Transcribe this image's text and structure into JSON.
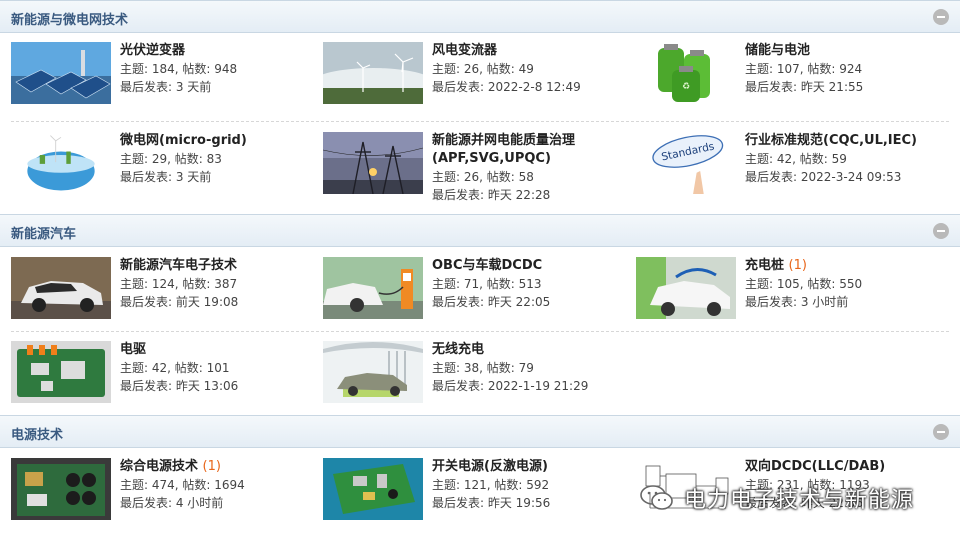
{
  "sections": [
    {
      "title": "新能源与微电网技术",
      "items": [
        {
          "title": "光伏逆变器",
          "new": "",
          "topics": "主题: 184, 帖数: 948",
          "last": "最后发表: 3 天前",
          "icon": "solar-panel-thumb"
        },
        {
          "title": "风电变流器",
          "new": "",
          "topics": "主题: 26, 帖数: 49",
          "last": "最后发表: 2022-2-8 12:49",
          "icon": "wind-turbine-thumb"
        },
        {
          "title": "储能与电池",
          "new": "",
          "topics": "主题: 107, 帖数: 924",
          "last": "最后发表: 昨天 21:55",
          "icon": "battery-thumb"
        },
        {
          "title": "微电网(micro-grid)",
          "new": "",
          "topics": "主题: 29, 帖数: 83",
          "last": "最后发表: 3 天前",
          "icon": "microgrid-thumb"
        },
        {
          "title": "新能源并网电能质量治理(APF,SVG,UPQC)",
          "new": "",
          "topics": "主题: 26, 帖数: 58",
          "last": "最后发表: 昨天 22:28",
          "icon": "power-tower-thumb"
        },
        {
          "title": "行业标准规范(CQC,UL,IEC)",
          "new": "",
          "topics": "主题: 42, 帖数: 59",
          "last": "最后发表: 2022-3-24 09:53",
          "icon": "standards-thumb",
          "thumb_text": "Standards"
        }
      ]
    },
    {
      "title": "新能源汽车",
      "items": [
        {
          "title": "新能源汽车电子技术",
          "new": "",
          "topics": "主题: 124, 帖数: 387",
          "last": "最后发表: 前天 19:08",
          "icon": "ev-car-thumb"
        },
        {
          "title": "OBC与车载DCDC",
          "new": "",
          "topics": "主题: 71, 帖数: 513",
          "last": "最后发表: 昨天 22:05",
          "icon": "obc-charging-thumb"
        },
        {
          "title": "充电桩",
          "new": "(1)",
          "topics": "主题: 105, 帖数: 550",
          "last": "最后发表: 3 小时前",
          "icon": "charging-pile-thumb"
        },
        {
          "title": "电驱",
          "new": "",
          "topics": "主题: 42, 帖数: 101",
          "last": "最后发表: 昨天 13:06",
          "icon": "motor-drive-thumb"
        },
        {
          "title": "无线充电",
          "new": "",
          "topics": "主题: 38, 帖数: 79",
          "last": "最后发表: 2022-1-19 21:29",
          "icon": "wireless-charging-thumb"
        }
      ]
    },
    {
      "title": "电源技术",
      "items": [
        {
          "title": "综合电源技术",
          "new": "(1)",
          "topics": "主题: 474, 帖数: 1694",
          "last": "最后发表: 4 小时前",
          "icon": "power-board-thumb"
        },
        {
          "title": "开关电源(反激电源)",
          "new": "",
          "topics": "主题: 121, 帖数: 592",
          "last": "最后发表: 昨天 19:56",
          "icon": "pcb-thumb"
        },
        {
          "title": "双向DCDC(LLC/DAB)",
          "new": "",
          "topics": "主题: 231, 帖数: 1193",
          "last": "最后发表: 昨天 22:56",
          "icon": "schematic-thumb"
        }
      ]
    }
  ],
  "watermark": {
    "text": "电力电子技术与新能源",
    "icon": "wechat-icon"
  },
  "colors": {
    "header_text": "#3a5a80",
    "accent_new": "#e8661b"
  }
}
